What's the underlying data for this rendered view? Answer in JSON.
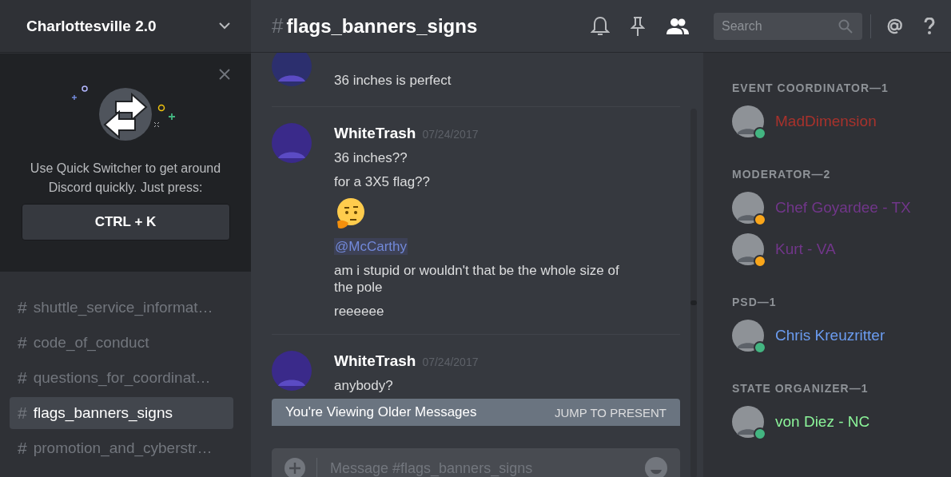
{
  "server": {
    "name": "Charlottesville 2.0"
  },
  "quick_switcher": {
    "text": "Use Quick Switcher to get around Discord quickly. Just press:",
    "shortcut": "CTRL + K"
  },
  "channels": [
    {
      "hash": "#",
      "name": "shuttle_service_informat…",
      "selected": false
    },
    {
      "hash": "#",
      "name": "code_of_conduct",
      "selected": false
    },
    {
      "hash": "#",
      "name": "questions_for_coordinat…",
      "selected": false
    },
    {
      "hash": "#",
      "name": "flags_banners_signs",
      "selected": true
    },
    {
      "hash": "#",
      "name": "promotion_and_cyberstr…",
      "selected": false
    }
  ],
  "header": {
    "hash": "#",
    "channel": "flags_banners_signs",
    "search_placeholder": "Search"
  },
  "messages": [
    {
      "lines": [
        {
          "kind": "text",
          "text": "36 inches is perfect"
        }
      ]
    },
    {
      "author": "WhiteTrash",
      "timestamp": "07/24/2017",
      "lines": [
        {
          "kind": "text",
          "text": "36 inches??"
        },
        {
          "kind": "text",
          "text": "for a 3X5 flag??"
        },
        {
          "kind": "emoji"
        },
        {
          "kind": "mention",
          "text": "@McCarthy"
        },
        {
          "kind": "text",
          "text": "am i stupid or wouldn't that be the whole size of the pole"
        },
        {
          "kind": "text",
          "text": "reeeeee"
        }
      ]
    },
    {
      "author": "WhiteTrash",
      "timestamp": "07/24/2017",
      "lines": [
        {
          "kind": "text",
          "text": "anybody?"
        }
      ]
    }
  ],
  "older_banner": {
    "text": "You're Viewing Older Messages",
    "action": "JUMP TO PRESENT"
  },
  "composer": {
    "placeholder": "Message #flags_banners_signs"
  },
  "member_groups": [
    {
      "title": "EVENT COORDINATOR—1",
      "members": [
        {
          "name": "MadDimension",
          "color": "#a8322c",
          "status": {
            "color": "#43b581"
          }
        }
      ]
    },
    {
      "title": "MODERATOR—2",
      "members": [
        {
          "name": "Chef Goyardee - TX",
          "color": "#71368a",
          "status": {
            "color": "#faa61a"
          }
        },
        {
          "name": "Kurt - VA",
          "color": "#71368a",
          "status": {
            "color": "#faa61a"
          }
        }
      ]
    },
    {
      "title": "PSD—1",
      "members": [
        {
          "name": "Chris Kreuzritter",
          "color": "#6b9cf0",
          "status": {
            "color": "#43b581"
          }
        }
      ]
    },
    {
      "title": "STATE ORGANIZER—1",
      "members": [
        {
          "name": "von Diez - NC",
          "color": "#8cf59a",
          "status": {
            "color": "#43b581"
          }
        }
      ]
    }
  ]
}
